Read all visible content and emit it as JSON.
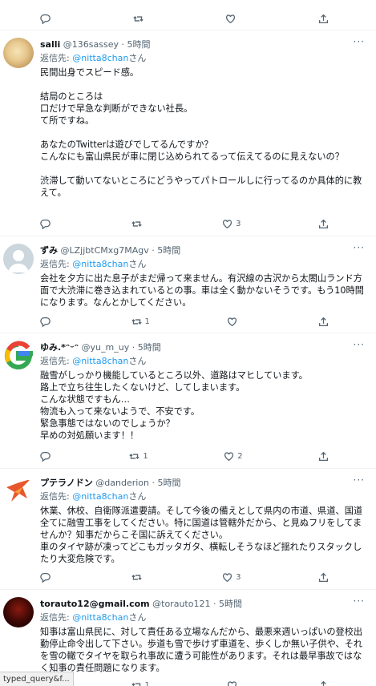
{
  "top_partial": {
    "text": "……………………………………………………………"
  },
  "tweets": [
    {
      "name": "salli",
      "handle": "@136sassey",
      "time": "5時間",
      "reply_prefix": "返信先:",
      "reply_to": "@nitta8chan",
      "reply_suffix": "さん",
      "text": "民間出身でスピード感。\n\n結局のところは\n口だけで早急な判断ができない社長。\nて所ですね。\n\nあなたのTwitterは遊びでしてるんですか？\nこんなにも富山県民が車に閉じ込められてるって伝えてるのに見えないの？\n\n渋滞して動いてないところにどうやってパトロールしに行ってるのか具体的に教えて。",
      "replies": "",
      "retweets": "",
      "likes": "3"
    },
    {
      "name": "ずみ",
      "handle": "@LZjjbtCMxg7MAgv",
      "time": "5時間",
      "reply_prefix": "返信先:",
      "reply_to": "@nitta8chan",
      "reply_suffix": "さん",
      "text": "会社を夕方に出た息子がまだ帰って来ません。有沢線の古沢から太閤山ランド方面で大渋滞に巻き込まれているとの事。車は全く動かないそうです。もう10時間になります。なんとかしてください。",
      "replies": "",
      "retweets": "1",
      "likes": ""
    },
    {
      "name": "ゆみ.*ᵔᵕᵔ",
      "handle": "@yu_m_uy",
      "time": "5時間",
      "reply_prefix": "返信先:",
      "reply_to": "@nitta8chan",
      "reply_suffix": "さん",
      "text": "融雪がしっかり機能しているところ以外、道路はマヒしています。\n路上で立ち往生したくないけど、してしまいます。\nこんな状態ですもん…\n物流も入って来ないようで、不安です。\n緊急事態ではないのでしょうか？\n早めの対処願います！！",
      "replies": "",
      "retweets": "1",
      "likes": "2"
    },
    {
      "name": "プテラノドン",
      "handle": "@danderion",
      "time": "5時間",
      "reply_prefix": "返信先:",
      "reply_to": "@nitta8chan",
      "reply_suffix": "さん",
      "text": "休業、休校、自衛隊派遣要請。そして今後の備えとして県内の市道、県道、国道全てに融雪工事をしてください。特に国道は管轄外だから、と見ぬフリをしてませんか？知事だからこそ国に訴えてください。\n車のタイヤ跡が凍ってどこもガッタガタ、横転しそうなほど揺れたりスタックしたり大変危険です。",
      "replies": "",
      "retweets": "",
      "likes": "3"
    },
    {
      "name": "torauto12@gmail.com",
      "handle": "@torauto121",
      "time": "5時間",
      "reply_prefix": "返信先:",
      "reply_to": "@nitta8chan",
      "reply_suffix": "さん",
      "text": "知事は富山県民に、対して責任ある立場なんだから、最悪来週いっぱいの登校出勤停止命令出して下さい。歩道も雪で歩けず車道を、歩くしか無い子供や、それを雪の轍でタイヤを取られ事故に遭う可能性があります。それは最早事故ではなく知事の責任問題になります。",
      "replies": "",
      "retweets": "1",
      "likes": ""
    }
  ],
  "icons": {
    "reply": "reply-icon",
    "retweet": "retweet-icon",
    "like": "heart-icon",
    "share": "share-icon",
    "more": "more-icon"
  },
  "more_label": "···",
  "status_bar": "typed_query&f..."
}
